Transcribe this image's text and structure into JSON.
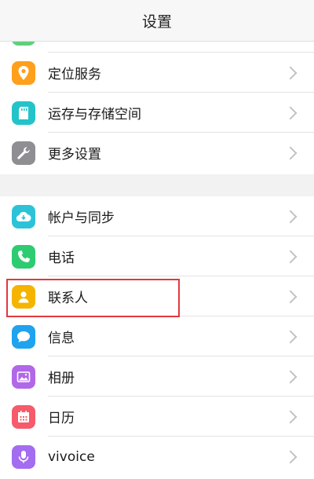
{
  "header": {
    "title": "设置"
  },
  "group1": {
    "items": [
      {
        "label": "",
        "icon": "partial-icon",
        "color": "#5fd07a"
      },
      {
        "label": "定位服务",
        "icon": "location-icon",
        "color": "#ff9f1a"
      },
      {
        "label": "运存与存储空间",
        "icon": "storage-icon",
        "color": "#23c4c9"
      },
      {
        "label": "更多设置",
        "icon": "wrench-icon",
        "color": "#8e8e93"
      }
    ]
  },
  "group2": {
    "items": [
      {
        "label": "帐户与同步",
        "icon": "cloud-icon",
        "color": "#2cc3d8"
      },
      {
        "label": "电话",
        "icon": "phone-icon",
        "color": "#2ecc71"
      },
      {
        "label": "联系人",
        "icon": "contact-icon",
        "color": "#f5b400"
      },
      {
        "label": "信息",
        "icon": "message-icon",
        "color": "#1fa3ee"
      },
      {
        "label": "相册",
        "icon": "gallery-icon",
        "color": "#b068e8"
      },
      {
        "label": "日历",
        "icon": "calendar-icon",
        "color": "#f55b6a"
      },
      {
        "label": "vivoice",
        "icon": "mic-icon",
        "color": "#a46cf0"
      }
    ]
  },
  "highlight_color": "#e0393e"
}
